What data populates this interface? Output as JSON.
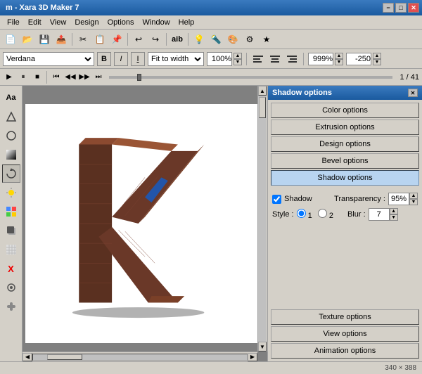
{
  "titlebar": {
    "title": "m - Xara 3D Maker 7",
    "minimize": "−",
    "maximize": "□",
    "close": "✕"
  },
  "menubar": {
    "items": [
      "File",
      "Edit",
      "View",
      "Design",
      "Options",
      "Window",
      "Help"
    ]
  },
  "fontbar": {
    "font_name": "Verdana",
    "bold": "B",
    "italic": "I",
    "fit_width": "Fit to width",
    "zoom_value": "100%",
    "zoom_percent_sign": "%",
    "align_left": "≡",
    "align_center": "≡",
    "align_right": "≡",
    "zoom_999": "999%",
    "offset_minus250": "-250"
  },
  "playbar": {
    "frame_display": "1 / 41",
    "play": "▶",
    "pause": "⏸",
    "stop": "■",
    "prev_start": "⏮",
    "prev": "◀◀",
    "next": "▶▶",
    "next_end": "⏭"
  },
  "left_toolbar": {
    "tools": [
      "Aa",
      "⬡",
      "⬤",
      "▲",
      "✦",
      "🔧",
      "⬛",
      "✂",
      "⭕",
      "X",
      "⚙",
      "🎨"
    ]
  },
  "right_panel": {
    "title": "Shadow options",
    "buttons": [
      {
        "label": "Color options",
        "active": false
      },
      {
        "label": "Extrusion options",
        "active": false
      },
      {
        "label": "Design options",
        "active": false
      },
      {
        "label": "Bevel options",
        "active": false
      },
      {
        "label": "Shadow options",
        "active": true
      }
    ],
    "shadow_check_label": "Shadow",
    "transparency_label": "Transparency :",
    "transparency_value": "95%",
    "style_label": "Style :",
    "style_option1": "1",
    "style_option2": "2",
    "blur_label": "Blur :",
    "blur_value": "7",
    "bottom_buttons": [
      {
        "label": "Texture options"
      },
      {
        "label": "View options"
      },
      {
        "label": "Animation options"
      }
    ]
  },
  "status_bar": {
    "dimensions": "340 × 388"
  }
}
